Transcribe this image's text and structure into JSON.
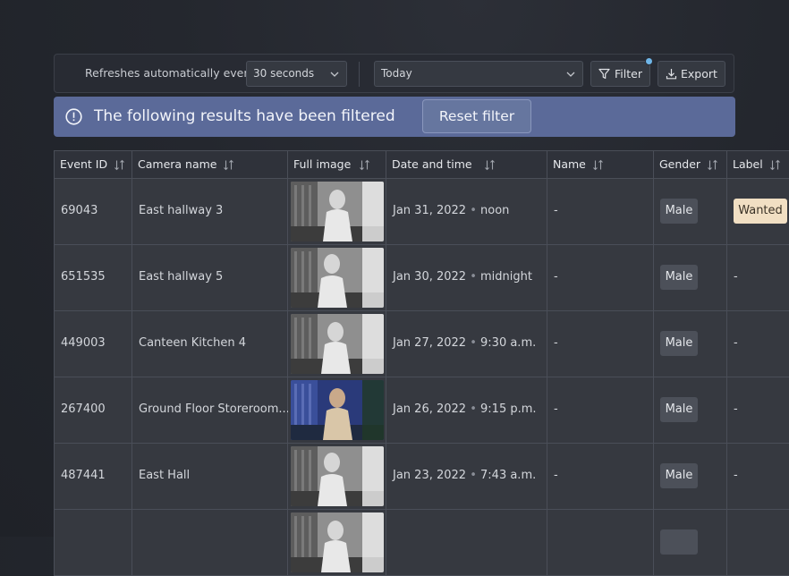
{
  "toolbar": {
    "refresh_label": "Refreshes automatically every",
    "refresh_value": "30 seconds",
    "date_value": "Today",
    "filter_label": "Filter",
    "export_label": "Export"
  },
  "banner": {
    "message": "The following results have been filtered",
    "reset_label": "Reset filter"
  },
  "table": {
    "headers": [
      "Event ID",
      "Camera name",
      "Full image",
      "Date and time",
      "Name",
      "Gender",
      "Label"
    ],
    "rows": [
      {
        "event_id": "69043",
        "camera": "East hallway 3",
        "date": "Jan 31, 2022",
        "time": "noon",
        "name": "-",
        "gender": "Male",
        "label": "Wanted"
      },
      {
        "event_id": "651535",
        "camera": "East hallway 5",
        "date": "Jan 30, 2022",
        "time": "midnight",
        "name": "-",
        "gender": "Male",
        "label": "-"
      },
      {
        "event_id": "449003",
        "camera": "Canteen Kitchen 4",
        "date": "Jan 27, 2022",
        "time": "9:30 a.m.",
        "name": "-",
        "gender": "Male",
        "label": "-"
      },
      {
        "event_id": "267400",
        "camera": "Ground Floor Storeroom...",
        "date": "Jan 26, 2022",
        "time": "9:15 p.m.",
        "name": "-",
        "gender": "Male",
        "label": "-"
      },
      {
        "event_id": "487441",
        "camera": "East Hall",
        "date": "Jan 23, 2022",
        "time": "7:43 a.m.",
        "name": "-",
        "gender": "Male",
        "label": "-"
      }
    ],
    "thumbnail_tones": [
      "grayscale",
      "grayscale",
      "grayscale",
      "blue-tinted",
      "grayscale",
      "grayscale"
    ]
  },
  "icons": {
    "refresh_chevron": "chevron-down-icon",
    "date_chevron": "chevron-down-icon",
    "filter": "funnel-icon",
    "export": "download-icon",
    "banner": "info-circle-icon",
    "sort": "sort-arrows-icon"
  },
  "colors": {
    "banner": "#5b6a99",
    "wanted_badge": "#f1dfc3",
    "filter_dot": "#6fb6e8"
  }
}
